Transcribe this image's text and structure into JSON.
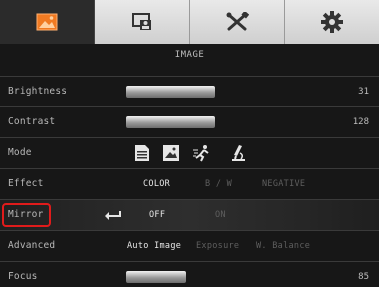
{
  "tabs": [
    {
      "icon": "image-icon",
      "active": true
    },
    {
      "icon": "presenter-icon",
      "active": false
    },
    {
      "icon": "tools-icon",
      "active": false
    },
    {
      "icon": "gear-icon",
      "active": false
    }
  ],
  "colors": {
    "accent": "#f07a22",
    "highlight": "#e01b1b"
  },
  "page_title": "IMAGE",
  "rows": {
    "brightness": {
      "label": "Brightness",
      "value": "31"
    },
    "contrast": {
      "label": "Contrast",
      "value": "128"
    },
    "mode": {
      "label": "Mode",
      "icons": [
        "document-mode-icon",
        "photo-mode-icon",
        "motion-mode-icon",
        "microscope-mode-icon"
      ]
    },
    "effect": {
      "label": "Effect",
      "options": [
        "COLOR",
        "B / W",
        "NEGATIVE"
      ],
      "selected": "COLOR"
    },
    "mirror": {
      "label": "Mirror",
      "options": [
        "OFF",
        "ON"
      ],
      "selected": "OFF"
    },
    "advanced": {
      "label": "Advanced",
      "options": [
        "Auto Image",
        "Exposure",
        "W. Balance"
      ],
      "selected": "Auto Image"
    },
    "focus": {
      "label": "Focus",
      "value": "85"
    }
  }
}
